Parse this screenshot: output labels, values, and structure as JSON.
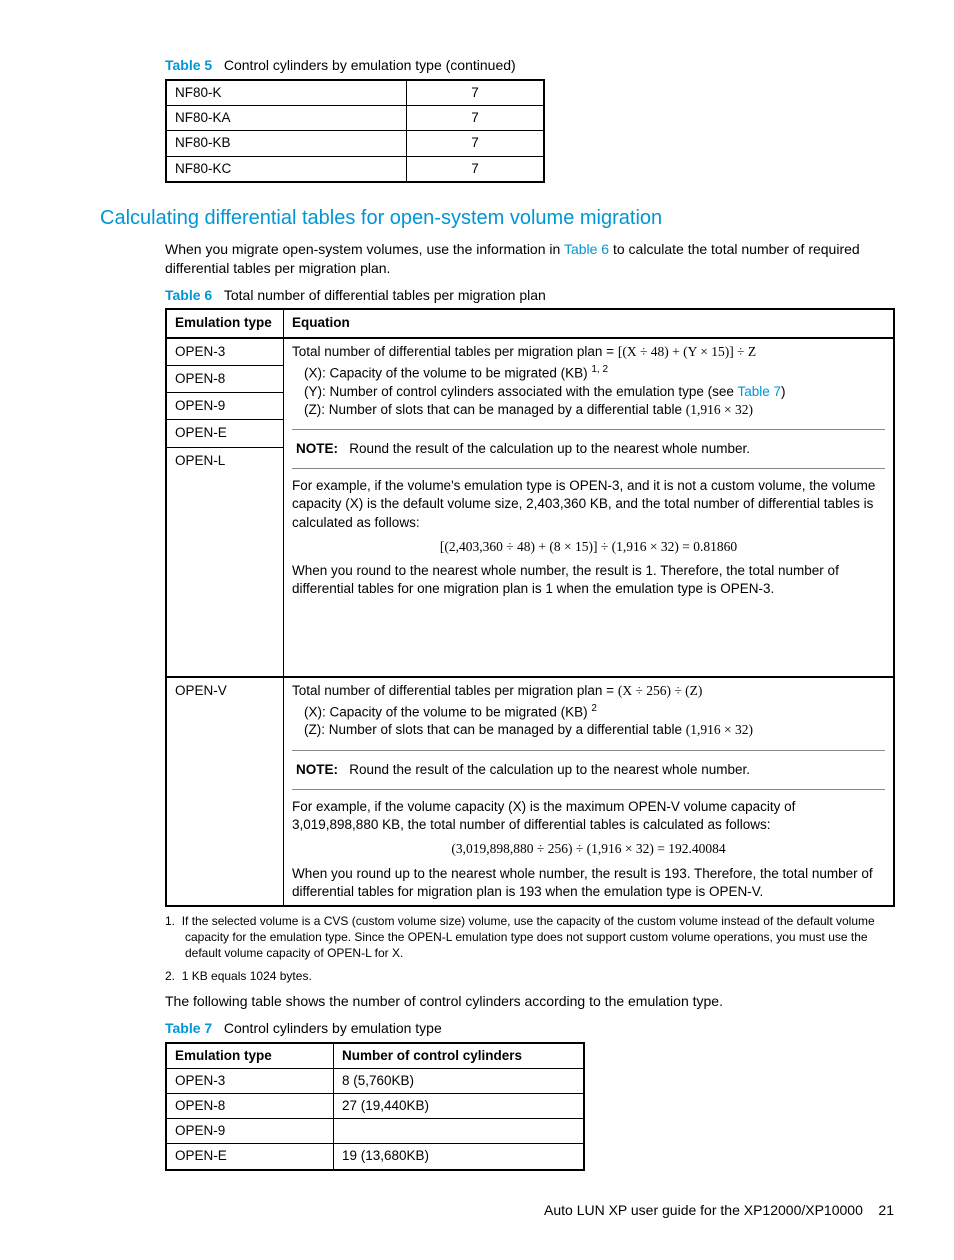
{
  "table5": {
    "label": "Table 5",
    "caption": "Control cylinders by emulation type (continued)",
    "rows": [
      {
        "c1": "NF80-K",
        "c2": "7"
      },
      {
        "c1": "NF80-KA",
        "c2": "7"
      },
      {
        "c1": "NF80-KB",
        "c2": "7"
      },
      {
        "c1": "NF80-KC",
        "c2": "7"
      }
    ]
  },
  "section_heading": "Calculating differential tables for open-system volume migration",
  "intro_a": "When you migrate open-system volumes, use the information in ",
  "intro_link": "Table 6",
  "intro_b": " to calculate the total number of required differential tables per migration plan.",
  "table6": {
    "label": "Table 6",
    "caption": "Total number of differential tables per migration plan",
    "h1": "Emulation type",
    "h2": "Equation",
    "etypes_group1": [
      "OPEN-3",
      "OPEN-8",
      "OPEN-9",
      "OPEN-E",
      "OPEN-L"
    ],
    "g1_line1": "Total number of differential tables per migration plan = ",
    "g1_eq1": "[(X ÷ 48) + (Y × 15)] ÷ Z",
    "g1_x": "(X): Capacity of the volume to be migrated (KB) ",
    "g1_x_sup": "1, 2",
    "g1_y_a": "(Y): Number of control cylinders associated with the emulation type (see ",
    "g1_y_link": "Table 7",
    "g1_y_b": ")",
    "g1_z": "(Z): Number of slots that can be managed by a differential table   ",
    "g1_z_eq": "(1,916 × 32)",
    "note_label": "NOTE:",
    "note_text": "Round the result of the calculation up to the nearest whole number.",
    "g1_ex1": "For example, if the volume's emulation type is OPEN-3, and it is not a custom volume, the volume capacity (X) is the default volume size, 2,403,360 KB, and the total number of differential tables is calculated as follows:",
    "g1_calc": "[(2,403,360 ÷ 48) + (8 × 15)] ÷ (1,916 × 32) = 0.81860",
    "g1_ex2": "When you round to the nearest whole number, the result is 1. Therefore, the total number of differential tables for one migration plan is 1 when the emulation type is OPEN-3.",
    "etype_g2": "OPEN-V",
    "g2_line1": "Total number of differential tables per migration plan = ",
    "g2_eq1": "(X ÷ 256) ÷ (Z)",
    "g2_x": "(X): Capacity of the volume to be migrated (KB) ",
    "g2_x_sup": "2",
    "g2_z": "(Z): Number of slots that can be managed by a differential table   ",
    "g2_z_eq": "(1,916 × 32)",
    "g2_ex1": "For example, if the volume capacity (X) is the maximum OPEN-V volume capacity of 3,019,898,880 KB, the total number of differential tables is calculated as follows:",
    "g2_calc": "(3,019,898,880 ÷ 256) ÷ (1,916 × 32) = 192.40084",
    "g2_ex2": "When you round up to the nearest whole number, the result is 193. Therefore, the total number of differential tables for migration plan is 193 when the emulation type is OPEN-V."
  },
  "fn1_no": "1.",
  "fn1": "If the selected volume is a CVS (custom volume size) volume, use the capacity of the custom volume instead of the default volume capacity for the emulation type. Since the OPEN-L emulation type does not support custom volume operations, you must use the default volume capacity of OPEN-L for X.",
  "fn2_no": "2.",
  "fn2": "1 KB equals 1024 bytes.",
  "after_para": "The following table shows the number of control cylinders according to the emulation type.",
  "table7": {
    "label": "Table 7",
    "caption": "Control cylinders by emulation type",
    "h1": "Emulation type",
    "h2": "Number of control cylinders",
    "rows": [
      {
        "c1": "OPEN-3",
        "c2": "8 (5,760KB)"
      },
      {
        "c1": "OPEN-8",
        "c2": "27 (19,440KB)"
      },
      {
        "c1": "OPEN-9",
        "c2": ""
      },
      {
        "c1": "OPEN-E",
        "c2": "19 (13,680KB)"
      }
    ]
  },
  "footer_text": "Auto LUN XP user guide for the XP12000/XP10000",
  "footer_page": "21"
}
